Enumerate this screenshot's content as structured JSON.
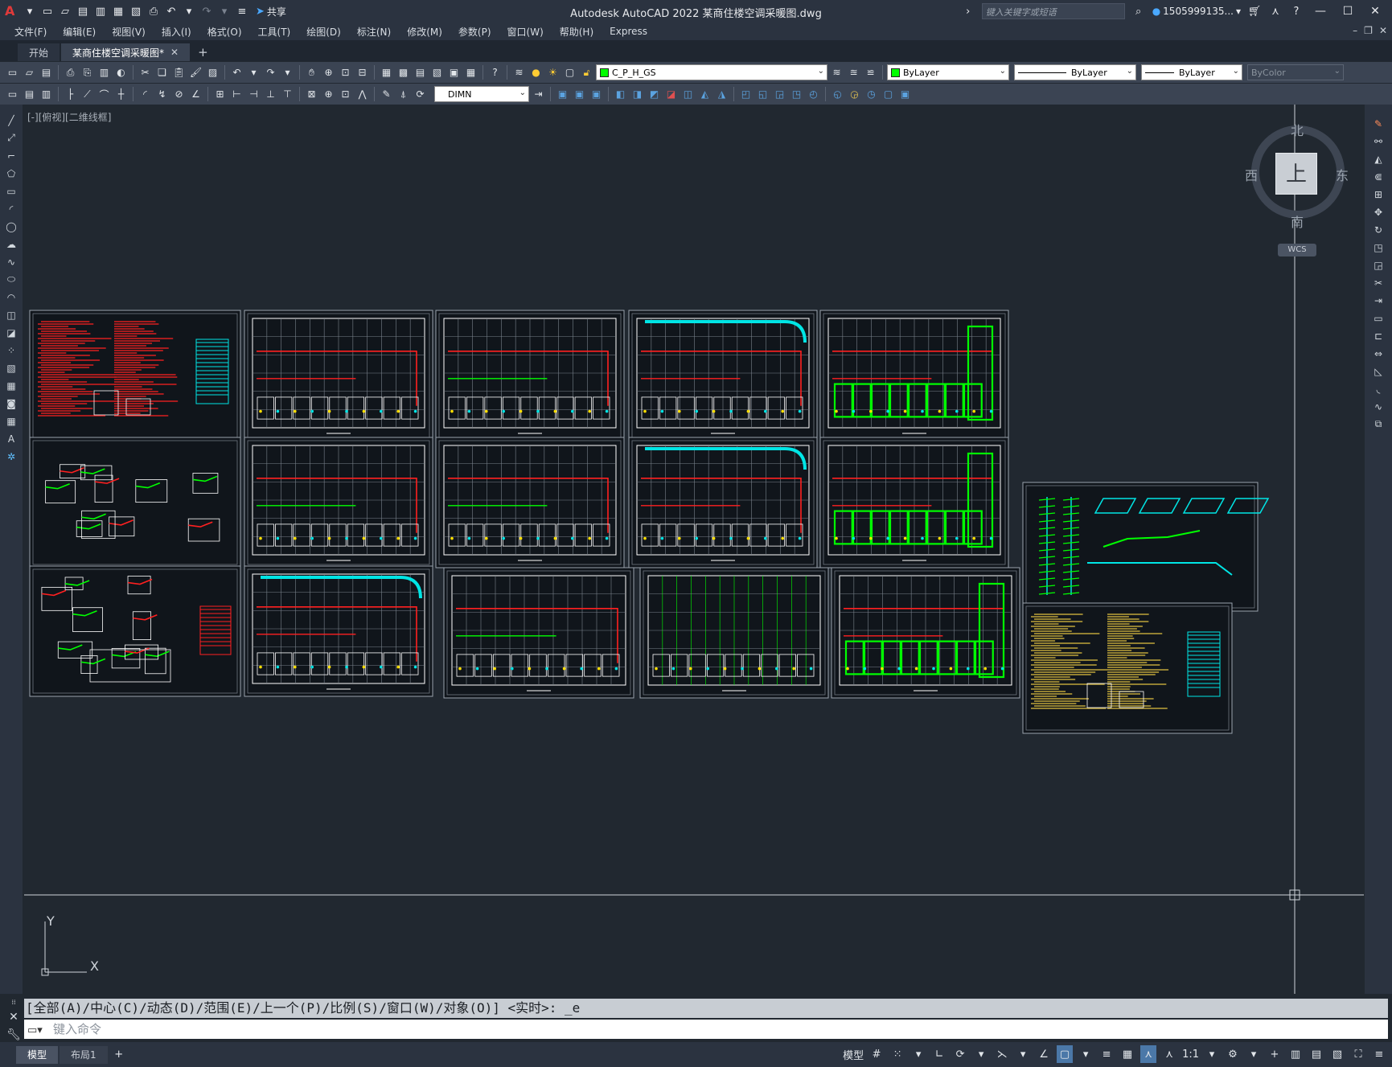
{
  "app": {
    "title": "Autodesk AutoCAD 2022    某商住楼空调采暖图.dwg",
    "share_label": "共享",
    "search_placeholder": "键入关键字或短语",
    "username": "1505999135...",
    "logo_letter": "A"
  },
  "menu": [
    "文件(F)",
    "编辑(E)",
    "视图(V)",
    "插入(I)",
    "格式(O)",
    "工具(T)",
    "绘图(D)",
    "标注(N)",
    "修改(M)",
    "参数(P)",
    "窗口(W)",
    "帮助(H)",
    "Express"
  ],
  "tabs": {
    "start": "开始",
    "active": "某商住楼空调采暖图*"
  },
  "toolbar": {
    "layer_name": "C_P_H_GS",
    "layer_color": "#00ff00",
    "color_value": "ByLayer",
    "linetype_value": "ByLayer",
    "lineweight_value": "ByLayer",
    "plotstyle_value": "ByColor",
    "dimstyle_value": "DIMN"
  },
  "viewport_label": "[-][俯视][二维线框]",
  "viewcube": {
    "north": "北",
    "south": "南",
    "east": "东",
    "west": "西",
    "face": "上",
    "wcs": "WCS"
  },
  "ucs": {
    "x": "X",
    "y": "Y"
  },
  "command": {
    "history": "[全部(A)/中心(C)/动态(D)/范围(E)/上一个(P)/比例(S)/窗口(W)/对象(O)] <实时>: _e",
    "placeholder": "键入命令"
  },
  "status": {
    "model_tab": "模型",
    "layout_tab": "布局1",
    "model_label": "模型",
    "scale": "1:1"
  },
  "colors": {
    "bg": "#212830",
    "red": "#ff2020",
    "green": "#00ff00",
    "cyan": "#00e5e5",
    "white": "#ffffff",
    "yellow": "#e0c040"
  }
}
